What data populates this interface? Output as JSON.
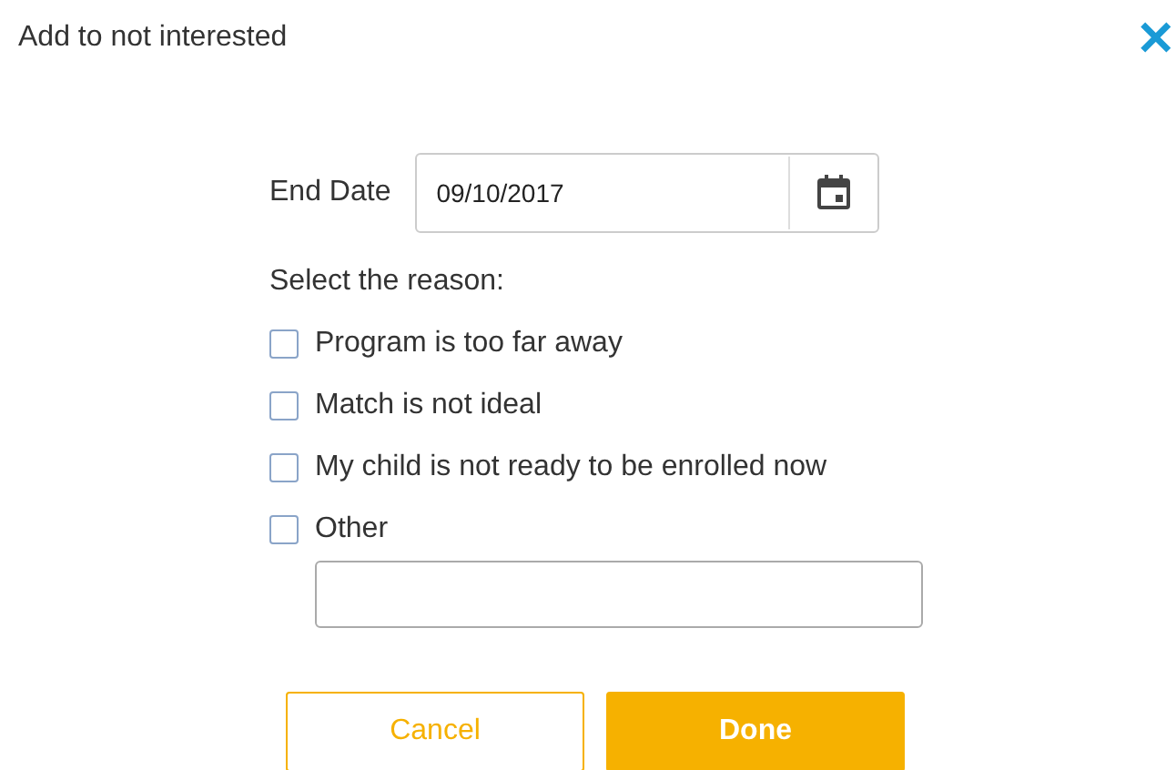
{
  "dialog": {
    "title": "Add to not interested",
    "close_icon": "✕"
  },
  "end_date": {
    "label": "End Date",
    "value": "09/10/2017"
  },
  "reason_prompt": "Select the reason:",
  "reasons": [
    {
      "label": "Program is too far away",
      "checked": false
    },
    {
      "label": "Match is not ideal",
      "checked": false
    },
    {
      "label": "My child is not ready to be enrolled now",
      "checked": false
    },
    {
      "label": "Other",
      "checked": false
    }
  ],
  "buttons": [
    {
      "label": "Cancel",
      "kind": "secondary"
    },
    {
      "label": "Done",
      "kind": "primary"
    }
  ]
}
